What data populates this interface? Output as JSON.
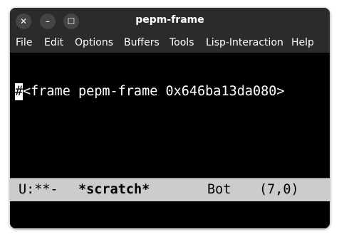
{
  "window": {
    "title": "pepm-frame",
    "close_glyph": "✕",
    "minimize_glyph": "–",
    "maximize_glyph": "☐"
  },
  "menubar": {
    "items": [
      "File",
      "Edit",
      "Options",
      "Buffers",
      "Tools",
      "Lisp-Interaction",
      "Help"
    ]
  },
  "buffer": {
    "cursor_char": "#",
    "line_rest": "<frame pepm-frame 0x646ba13da080>"
  },
  "modeline": {
    "status": "U:**-",
    "buffer_name": "*scratch*",
    "position": "Bot",
    "line_col": "(7,0)"
  },
  "colors": {
    "background": "#000000",
    "foreground": "#ffffff",
    "titlebar": "#2b2b2b",
    "modeline_bg": "#cccccc"
  }
}
